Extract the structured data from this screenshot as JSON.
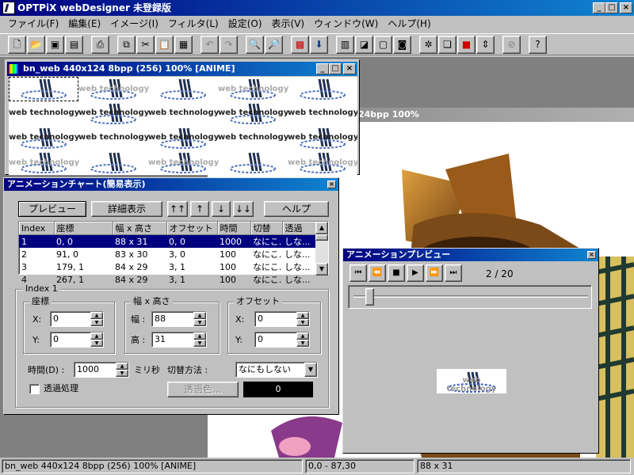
{
  "app": {
    "title": "OPTPiX webDesigner 未登録版"
  },
  "menu": [
    "ファイル(F)",
    "編集(E)",
    "イメージ(I)",
    "フィルタ(L)",
    "設定(O)",
    "表示(V)",
    "ウィンドウ(W)",
    "ヘルプ(H)"
  ],
  "image_window": {
    "title": "24bpp 100%"
  },
  "bn_window": {
    "title": "bn_web  440x124  8bpp (256)  100%  [ANIME]",
    "tile_text": "web technology"
  },
  "chart": {
    "title": "アニメーションチャート(簡易表示)",
    "buttons": {
      "preview": "プレビュー",
      "detail": "詳細表示",
      "first": "↑↑",
      "up": "↑",
      "down": "↓",
      "last": "↓↓",
      "help": "ヘルプ"
    },
    "columns": [
      "Index",
      "座標",
      "幅 x 高さ",
      "オフセット",
      "時間",
      "切替",
      "透過"
    ],
    "rows": [
      [
        "1",
        "0, 0",
        "88 x 31",
        "0, 0",
        "1000",
        "なにこ...",
        "しな..."
      ],
      [
        "2",
        "91, 0",
        "83 x 30",
        "3, 0",
        "100",
        "なにこ...",
        "しな..."
      ],
      [
        "3",
        "179, 1",
        "84 x 29",
        "3, 1",
        "100",
        "なにこ...",
        "しな..."
      ],
      [
        "4",
        "267, 1",
        "84 x 29",
        "3, 1",
        "100",
        "なにこ...",
        "しな..."
      ]
    ],
    "group_title": "Index 1",
    "coord": {
      "label": "座標",
      "x_label": "X:",
      "x": "0",
      "y_label": "Y:",
      "y": "0"
    },
    "size": {
      "label": "幅 x 高さ",
      "w_label": "幅 :",
      "w": "88",
      "h_label": "高 :",
      "h": "31"
    },
    "offset": {
      "label": "オフセット",
      "x_label": "X:",
      "x": "0",
      "y_label": "Y:",
      "y": "0"
    },
    "time_label": "時間(D) :",
    "time_value": "1000",
    "time_unit": "ミリ秒",
    "switch_label": "切替方法 :",
    "switch_value": "なにもしない",
    "transparency_label": "透過処理",
    "transparency_color_button": "透過色...",
    "transparency_value": "0"
  },
  "preview": {
    "title": "アニメーションプレビュー",
    "frame": "2 / 20",
    "image_text": "web technology"
  },
  "status": {
    "info": "bn_web  440x124  8bpp (256)  100%  [ANIME]",
    "coords": "0,0 - 87,30",
    "size": "88 x 31"
  }
}
